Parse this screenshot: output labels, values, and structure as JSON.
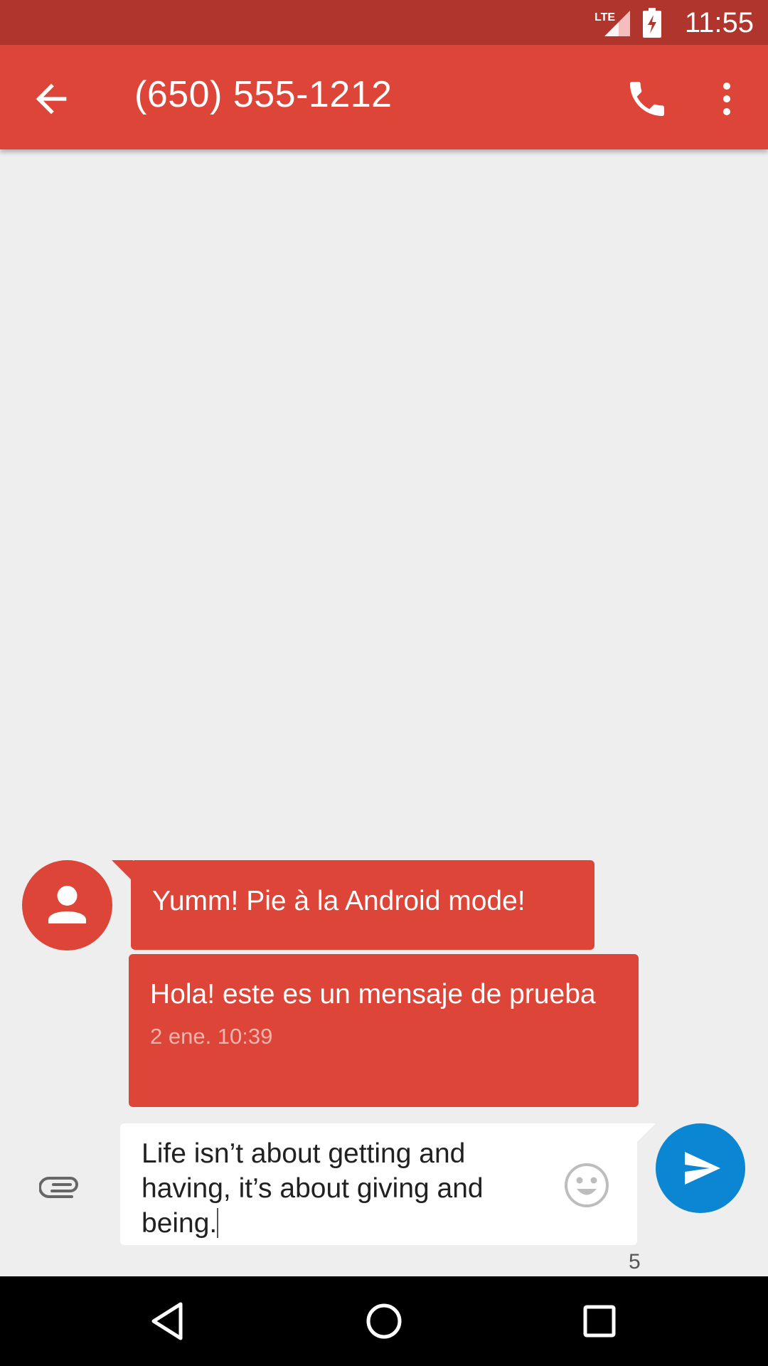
{
  "status_bar": {
    "time": "11:55",
    "network_label": "LTE",
    "icons": [
      "lte-signal-icon",
      "battery-charging-icon"
    ]
  },
  "app_bar": {
    "title": "(650) 555-1212",
    "background_color": "#dd4539",
    "icons": [
      "arrow-back-icon",
      "phone-icon",
      "more-vert-icon"
    ]
  },
  "messages": [
    {
      "text": "Yumm! Pie à la Android mode!",
      "timestamp": ""
    },
    {
      "text": "Hola! este es un mensaje de prueba",
      "timestamp": "2 ene. 10:39"
    }
  ],
  "compose": {
    "text": "Life isn’t about getting and having, it’s about giving and being.",
    "char_counter": "5",
    "icons": [
      "attach-icon",
      "emoji-icon",
      "send-icon"
    ],
    "send_button_color": "#0a86d3"
  },
  "nav_bar": {
    "icons": [
      "nav-back-icon",
      "nav-home-icon",
      "nav-recents-icon"
    ]
  }
}
